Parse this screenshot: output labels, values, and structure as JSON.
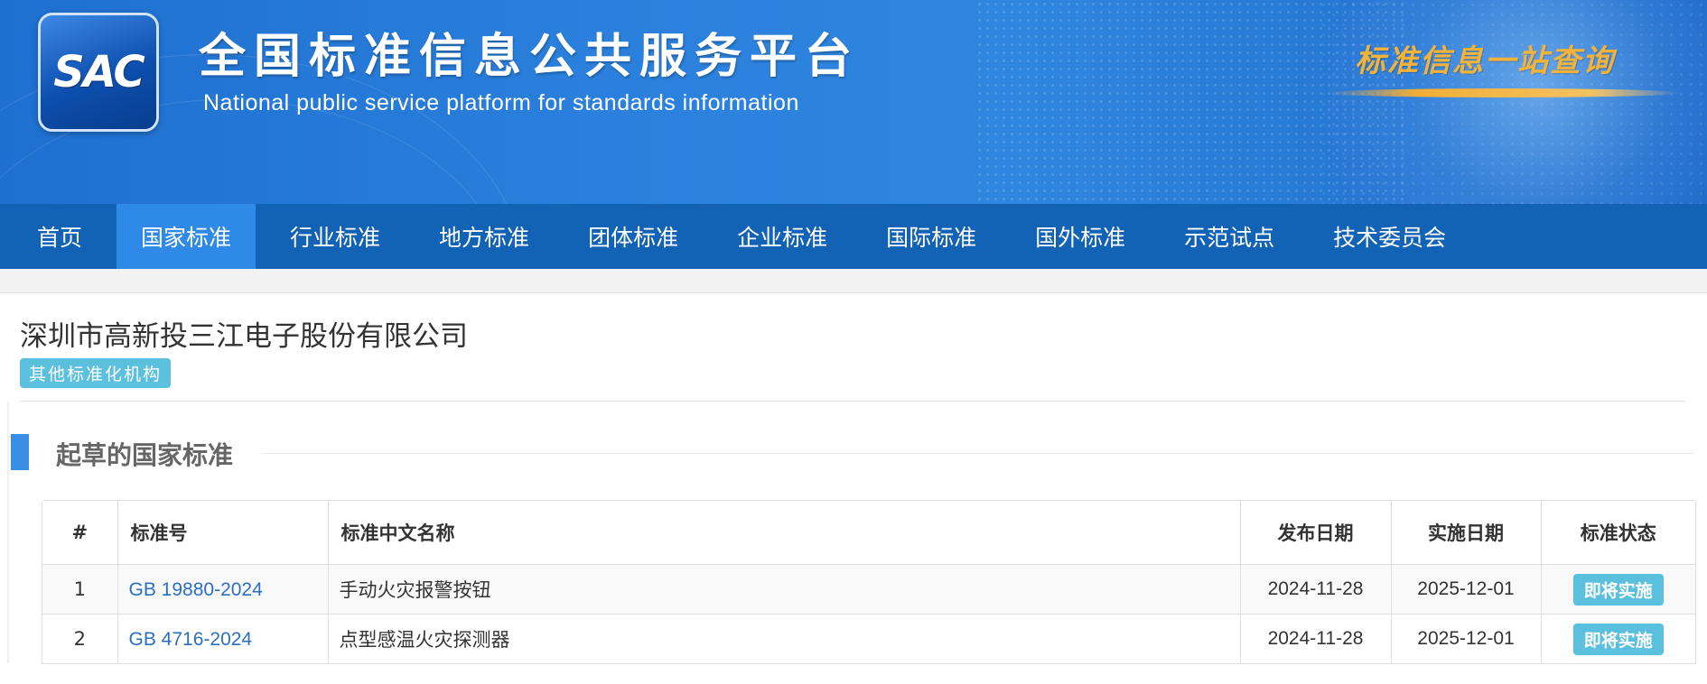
{
  "header": {
    "logo_text": "SAC",
    "title_cn": "全国标准信息公共服务平台",
    "title_en": "National public service platform  for standards information",
    "slogan": "标准信息一站查询"
  },
  "nav": {
    "items": [
      {
        "label": "首页"
      },
      {
        "label": "国家标准"
      },
      {
        "label": "行业标准"
      },
      {
        "label": "地方标准"
      },
      {
        "label": "团体标准"
      },
      {
        "label": "企业标准"
      },
      {
        "label": "国际标准"
      },
      {
        "label": "国外标准"
      },
      {
        "label": "示范试点"
      },
      {
        "label": "技术委员会"
      }
    ],
    "active_index": 1
  },
  "org": {
    "name": "深圳市高新投三江电子股份有限公司",
    "tag": "其他标准化机构"
  },
  "section": {
    "title": "起草的国家标准"
  },
  "table": {
    "columns": [
      "#",
      "标准号",
      "标准中文名称",
      "发布日期",
      "实施日期",
      "标准状态"
    ],
    "rows": [
      {
        "index": "1",
        "code": "GB 19880-2024",
        "name": "手动火灾报警按钮",
        "publish_date": "2024-11-28",
        "effective_date": "2025-12-01",
        "status": "即将实施"
      },
      {
        "index": "2",
        "code": "GB 4716-2024",
        "name": "点型感温火灾探测器",
        "publish_date": "2024-11-28",
        "effective_date": "2025-12-01",
        "status": "即将实施"
      }
    ]
  },
  "colors": {
    "banner": "#2a80dc",
    "nav": "#1262b5",
    "nav_active": "#2e8ae6",
    "tag": "#5bc0de",
    "link": "#2a6fc4",
    "section_bar": "#3a8ee6"
  }
}
